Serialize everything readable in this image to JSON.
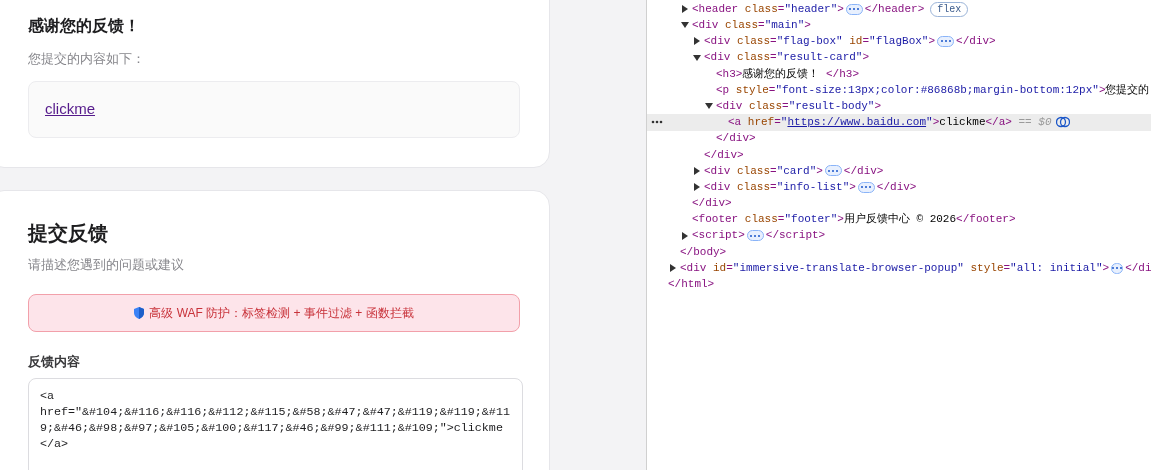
{
  "result_card": {
    "title": "感谢您的反馈！",
    "subtitle": "您提交的内容如下：",
    "link": "clickme"
  },
  "feedback_card": {
    "title": "提交反馈",
    "subtitle": "请描述您遇到的问题或建议",
    "alert": "高级 WAF 防护：标签检测 + 事件过滤 + 函数拦截",
    "field": {
      "label": "反馈内容",
      "value": "<a\nhref=\"&#104;&#116;&#116;&#112;&#115;&#58;&#47;&#47;&#119;&#119;&#119;&#46;&#98;&#97;&#105;&#100;&#117;&#46;&#99;&#111;&#109;\">clickme</a>"
    }
  },
  "devtools": {
    "tree": {
      "close": [
        {
          "kind": "tag",
          "text": "</html>"
        }
      ],
      "children": [
        {
          "close": [
            {
              "kind": "tag",
              "text": "</body>"
            }
          ],
          "children": [
            {
              "parts": [
                {
                  "kind": "tag",
                  "text": "<header"
                },
                {
                  "kind": "attr",
                  "text": " class"
                },
                {
                  "kind": "tag",
                  "text": "="
                },
                {
                  "kind": "val",
                  "text": "\"header\""
                },
                {
                  "kind": "tag",
                  "text": ">"
                },
                {
                  "kind": "dots"
                },
                {
                  "kind": "tag",
                  "text": "</header>"
                },
                {
                  "kind": "badge",
                  "text": "flex"
                }
              ],
              "expanded": false,
              "selected": false
            },
            {
              "parts": [
                {
                  "kind": "tag",
                  "text": "<div"
                },
                {
                  "kind": "attr",
                  "text": " class"
                },
                {
                  "kind": "tag",
                  "text": "="
                },
                {
                  "kind": "val",
                  "text": "\"main\""
                },
                {
                  "kind": "tag",
                  "text": ">"
                }
              ],
              "expanded": true,
              "selected": false,
              "close": [
                {
                  "kind": "tag",
                  "text": "</div>"
                }
              ],
              "children": [
                {
                  "parts": [
                    {
                      "kind": "tag",
                      "text": "<div"
                    },
                    {
                      "kind": "attr",
                      "text": " class"
                    },
                    {
                      "kind": "tag",
                      "text": "="
                    },
                    {
                      "kind": "val",
                      "text": "\"flag-box\""
                    },
                    {
                      "kind": "attr",
                      "text": " id"
                    },
                    {
                      "kind": "tag",
                      "text": "="
                    },
                    {
                      "kind": "val",
                      "text": "\"flagBox\""
                    },
                    {
                      "kind": "tag",
                      "text": ">"
                    },
                    {
                      "kind": "dots"
                    },
                    {
                      "kind": "tag",
                      "text": "</div>"
                    }
                  ],
                  "expanded": false,
                  "selected": false
                },
                {
                  "parts": [
                    {
                      "kind": "tag",
                      "text": "<div"
                    },
                    {
                      "kind": "attr",
                      "text": " class"
                    },
                    {
                      "kind": "tag",
                      "text": "="
                    },
                    {
                      "kind": "val",
                      "text": "\"result-card\""
                    },
                    {
                      "kind": "tag",
                      "text": ">"
                    }
                  ],
                  "expanded": true,
                  "selected": false,
                  "close": [
                    {
                      "kind": "tag",
                      "text": "</div>"
                    }
                  ],
                  "children": [
                    {
                      "parts": [
                        {
                          "kind": "tag",
                          "text": "<h3>"
                        },
                        {
                          "kind": "text",
                          "text": "感谢您的反馈！"
                        },
                        {
                          "kind": "tag",
                          "text": " </h3>"
                        }
                      ],
                      "selected": false
                    },
                    {
                      "parts": [
                        {
                          "kind": "tag",
                          "text": "<p"
                        },
                        {
                          "kind": "attr",
                          "text": " style"
                        },
                        {
                          "kind": "tag",
                          "text": "="
                        },
                        {
                          "kind": "val",
                          "text": "\"font-size:13px;color:#86868b;margin-bottom:12px\""
                        },
                        {
                          "kind": "tag",
                          "text": ">"
                        },
                        {
                          "kind": "text",
                          "text": "您提交的"
                        }
                      ],
                      "selected": false
                    },
                    {
                      "parts": [
                        {
                          "kind": "tag",
                          "text": "<div"
                        },
                        {
                          "kind": "attr",
                          "text": " class"
                        },
                        {
                          "kind": "tag",
                          "text": "="
                        },
                        {
                          "kind": "val",
                          "text": "\"result-body\""
                        },
                        {
                          "kind": "tag",
                          "text": ">"
                        }
                      ],
                      "expanded": true,
                      "selected": false,
                      "close": [
                        {
                          "kind": "tag",
                          "text": "</div>"
                        }
                      ],
                      "children": [
                        {
                          "parts": [
                            {
                              "kind": "tag",
                              "text": "<a"
                            },
                            {
                              "kind": "attr",
                              "text": " href"
                            },
                            {
                              "kind": "tag",
                              "text": "="
                            },
                            {
                              "kind": "val",
                              "text": "\""
                            },
                            {
                              "kind": "link",
                              "text": "https://www.baidu.com"
                            },
                            {
                              "kind": "val",
                              "text": "\""
                            },
                            {
                              "kind": "tag",
                              "text": ">"
                            },
                            {
                              "kind": "text",
                              "text": "clickme"
                            },
                            {
                              "kind": "tag",
                              "text": "</a>"
                            },
                            {
                              "kind": "muted",
                              "text": " == $0"
                            },
                            {
                              "kind": "icon"
                            }
                          ],
                          "selected": true
                        }
                      ]
                    }
                  ]
                },
                {
                  "parts": [
                    {
                      "kind": "tag",
                      "text": "<div"
                    },
                    {
                      "kind": "attr",
                      "text": " class"
                    },
                    {
                      "kind": "tag",
                      "text": "="
                    },
                    {
                      "kind": "val",
                      "text": "\"card\""
                    },
                    {
                      "kind": "tag",
                      "text": ">"
                    },
                    {
                      "kind": "dots"
                    },
                    {
                      "kind": "tag",
                      "text": "</div>"
                    }
                  ],
                  "expanded": false,
                  "selected": false
                },
                {
                  "parts": [
                    {
                      "kind": "tag",
                      "text": "<div"
                    },
                    {
                      "kind": "attr",
                      "text": " class"
                    },
                    {
                      "kind": "tag",
                      "text": "="
                    },
                    {
                      "kind": "val",
                      "text": "\"info-list\""
                    },
                    {
                      "kind": "tag",
                      "text": ">"
                    },
                    {
                      "kind": "dots"
                    },
                    {
                      "kind": "tag",
                      "text": "</div>"
                    }
                  ],
                  "expanded": false,
                  "selected": false
                }
              ]
            },
            {
              "parts": [
                {
                  "kind": "tag",
                  "text": "<footer"
                },
                {
                  "kind": "attr",
                  "text": " class"
                },
                {
                  "kind": "tag",
                  "text": "="
                },
                {
                  "kind": "val",
                  "text": "\"footer\""
                },
                {
                  "kind": "tag",
                  "text": ">"
                },
                {
                  "kind": "text",
                  "text": "用户反馈中心 © 2026"
                },
                {
                  "kind": "tag",
                  "text": "</footer>"
                }
              ],
              "selected": false
            },
            {
              "parts": [
                {
                  "kind": "tag",
                  "text": "<script>"
                },
                {
                  "kind": "dots"
                },
                {
                  "kind": "tag",
                  "text": "</script>"
                }
              ],
              "expanded": false,
              "selected": false
            }
          ]
        },
        {
          "parts": [
            {
              "kind": "tag",
              "text": "<div"
            },
            {
              "kind": "attr",
              "text": " id"
            },
            {
              "kind": "tag",
              "text": "="
            },
            {
              "kind": "val",
              "text": "\"immersive-translate-browser-popup\""
            },
            {
              "kind": "attr",
              "text": " style"
            },
            {
              "kind": "tag",
              "text": "="
            },
            {
              "kind": "val",
              "text": "\"all: initial\""
            },
            {
              "kind": "tag",
              "text": ">"
            },
            {
              "kind": "dots"
            },
            {
              "kind": "tag",
              "text": "</di"
            }
          ],
          "expanded": false,
          "selected": false
        }
      ]
    }
  }
}
